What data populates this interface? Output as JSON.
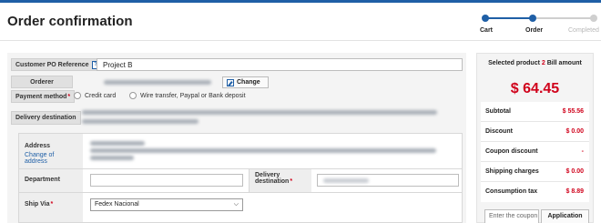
{
  "header": {
    "title": "Order confirmation"
  },
  "stepper": {
    "steps": [
      "Cart",
      "Order",
      "Completed"
    ],
    "current_step": 2
  },
  "form": {
    "po_reference": {
      "label": "Customer PO Reference",
      "help": "?",
      "value": "Project B"
    },
    "orderer": {
      "label": "Orderer",
      "change_label": "Change"
    },
    "payment_method": {
      "label": "Payment method",
      "required_mark": "*",
      "options": [
        "Credit card",
        "Wire transfer, Paypal or Bank deposit"
      ]
    },
    "delivery_destination": {
      "label": "Delivery destination"
    },
    "address": {
      "label": "Address",
      "change_link": "Change of address"
    },
    "department": {
      "label": "Department",
      "value": ""
    },
    "delivery_destination_field": {
      "label": "Delivery destination",
      "required_mark": "*"
    },
    "ship_via": {
      "label": "Ship Via",
      "required_mark": "*",
      "selected": "Fedex Nacional"
    }
  },
  "summary": {
    "heading_prefix": "Selected product ",
    "product_count": "2",
    "heading_suffix": " Bill amount",
    "total": "$ 64.45",
    "rows": [
      {
        "label": "Subtotal",
        "value": "$ 55.56"
      },
      {
        "label": "Discount",
        "value": "$ 0.00"
      },
      {
        "label": "Coupon discount",
        "value": "-"
      },
      {
        "label": "Shipping charges",
        "value": "$ 0.00"
      },
      {
        "label": "Consumption tax",
        "value": "$ 8.89"
      }
    ],
    "coupon_placeholder": "Enter the coupon",
    "coupon_button": "Application"
  },
  "colors": {
    "accent": "#1f5fa6",
    "price": "#d0021b",
    "panel": "#f4f4f4"
  }
}
